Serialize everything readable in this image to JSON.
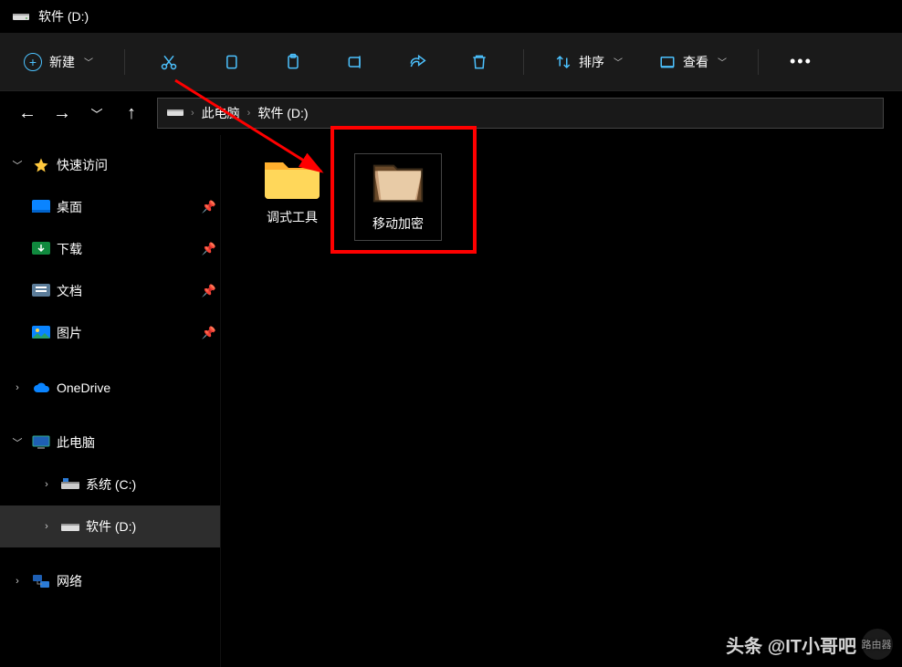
{
  "window": {
    "title": "软件 (D:)"
  },
  "toolbar": {
    "new_label": "新建",
    "sort_label": "排序",
    "view_label": "查看"
  },
  "breadcrumb": {
    "root": "此电脑",
    "current": "软件 (D:)"
  },
  "sidebar": {
    "quick_access": "快速访问",
    "desktop": "桌面",
    "downloads": "下载",
    "documents": "文档",
    "pictures": "图片",
    "onedrive": "OneDrive",
    "this_pc": "此电脑",
    "drive_c": "系统 (C:)",
    "drive_d": "软件 (D:)",
    "network": "网络"
  },
  "content": {
    "items": [
      {
        "label": "调式工具"
      },
      {
        "label": "移动加密"
      }
    ]
  },
  "watermark": {
    "text": "头条 @IT小哥吧",
    "sub": "路由器"
  }
}
